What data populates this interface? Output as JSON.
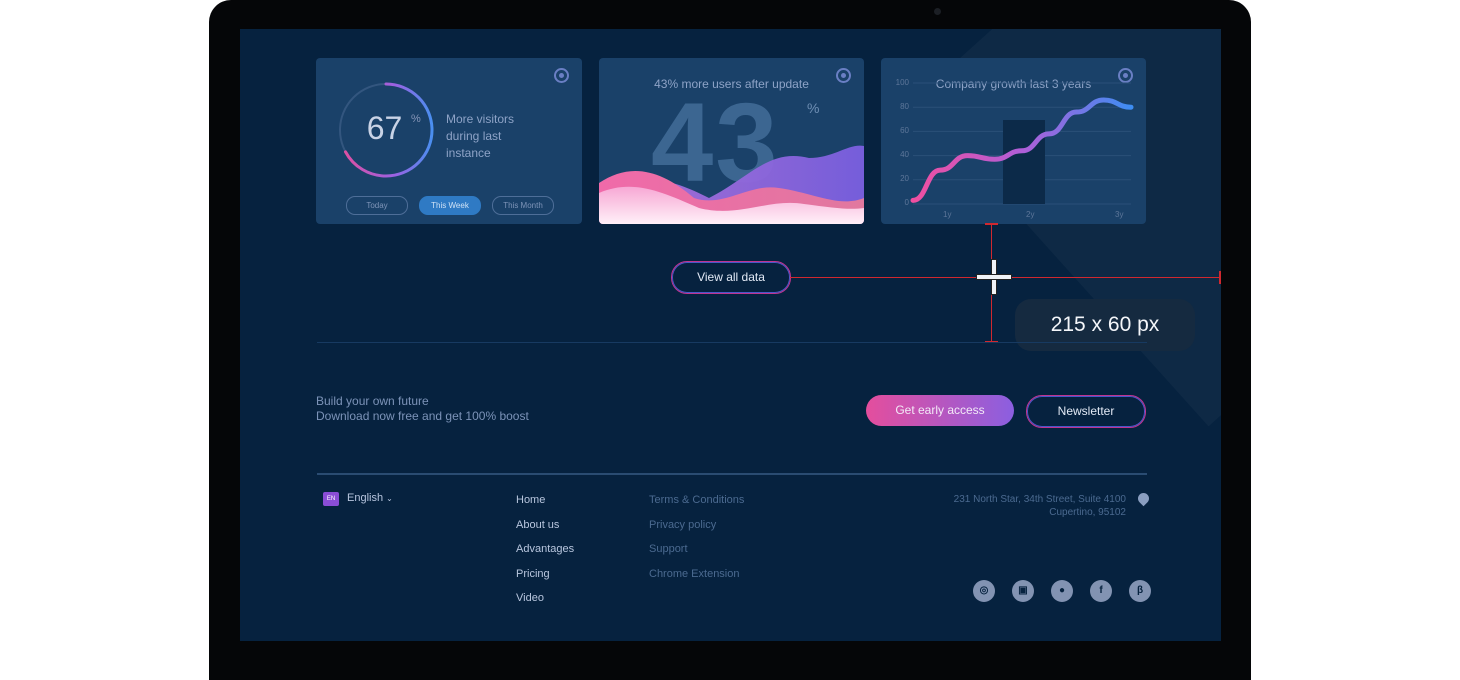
{
  "colors": {
    "screen_bg": "#06223f",
    "card_bg": "#1a4169",
    "accent_pink": "#e44e9d",
    "accent_purple": "#8b5fe0",
    "measure_red": "#d0282f"
  },
  "card_users": {
    "value": "67",
    "unit": "%",
    "progress": 0.67,
    "text_lines": [
      "More visitors",
      "during last",
      "instance"
    ],
    "pills": [
      "Today",
      "This Week",
      "This Month"
    ],
    "active_pill": 1,
    "icon": "gear-icon"
  },
  "card_update": {
    "title": "43% more users after update",
    "value": "43",
    "unit": "%",
    "icon": "gear-icon"
  },
  "card_growth": {
    "title": "Company growth last 3 years",
    "icon": "gear-icon"
  },
  "chart_data": {
    "type": "line",
    "title": "Company growth last 3 years",
    "y_ticks": [
      "100",
      "80",
      "60",
      "40",
      "20",
      "0"
    ],
    "x_ticks": [
      "1y",
      "2y",
      "3y"
    ],
    "ylim": [
      0,
      100
    ],
    "x": [
      0,
      0.4,
      0.8,
      1.2,
      1.6,
      2.0,
      2.4,
      2.8,
      3.2
    ],
    "series": [
      {
        "values": [
          3,
          28,
          40,
          37,
          44,
          58,
          76,
          86,
          80
        ]
      }
    ],
    "grid": true,
    "highlight_band": "2y"
  },
  "view_all_button": "View all data",
  "measure_tooltip": "215 x 60 px",
  "cta": {
    "line1": "Build your own future",
    "line2": "Download now free and get 100% boost",
    "early_access": "Get early access",
    "newsletter": "Newsletter"
  },
  "footer": {
    "lang_badge": "EN",
    "language": "English",
    "nav_main": [
      "Home",
      "About us",
      "Advantages",
      "Pricing",
      "Video"
    ],
    "nav_secondary": [
      "Terms & Conditions",
      "Privacy policy",
      "Support",
      "Chrome Extension"
    ],
    "address_line1": "231 North Star, 34th Street, Suite 4100",
    "address_line2": "Cupertino, 95102",
    "address_icon": "location-pin-icon",
    "social_icons": [
      "dribbble-icon",
      "instagram-icon",
      "medium-icon",
      "facebook-icon",
      "behance-icon"
    ]
  }
}
